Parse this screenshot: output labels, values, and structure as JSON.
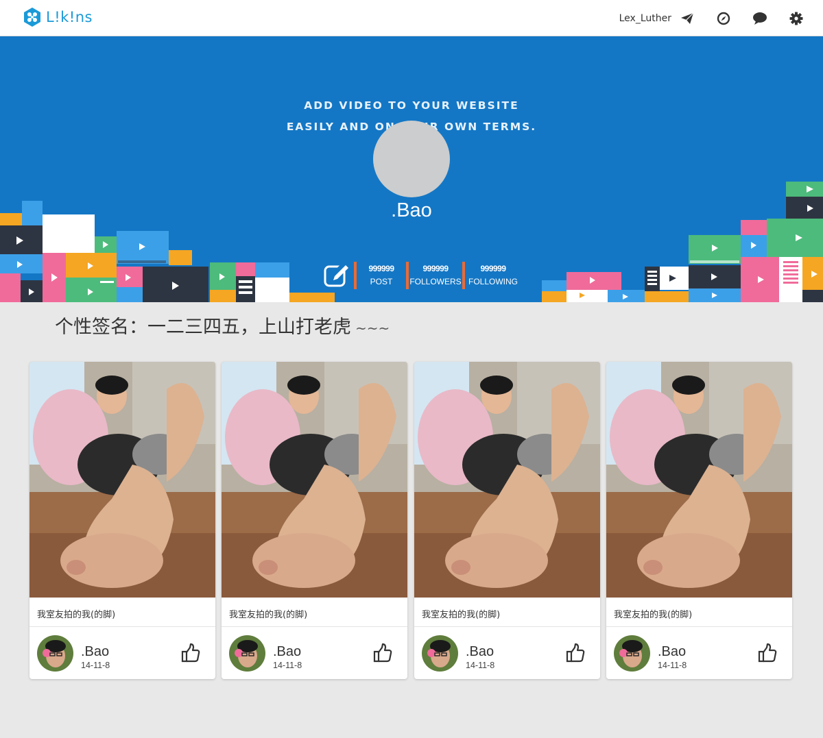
{
  "app": {
    "logo_text": "L!k!ns",
    "brand_color": "#1b9ad8"
  },
  "nav": {
    "username": "Lex_Luther",
    "icons": [
      "send-icon",
      "compass-icon",
      "chat-icon",
      "gear-icon"
    ]
  },
  "banner": {
    "tagline_line1": "ADD VIDEO TO YOUR WEBSITE",
    "tagline_line2": "EASILY AND ON YOUR OWN TERMS.",
    "background_color": "#1477c5",
    "profile_name": ".Bao",
    "stats": {
      "post_count": "999999",
      "post_label": "POST",
      "followers_count": "999999",
      "followers_label": "FOLLOWERS",
      "following_count": "999999",
      "following_label": "FOLLOWING"
    },
    "stat_divider_color": "#ef6a31"
  },
  "signature": {
    "text": "个性签名：一二三四五，上山打老虎",
    "suffix": "~~~"
  },
  "cards": [
    {
      "caption": "我室友拍的我(的脚)",
      "author": ".Bao",
      "date": "14-11-8"
    },
    {
      "caption": "我室友拍的我(的脚)",
      "author": ".Bao",
      "date": "14-11-8"
    },
    {
      "caption": "我室友拍的我(的脚)",
      "author": ".Bao",
      "date": "14-11-8"
    },
    {
      "caption": "我室友拍的我(的脚)",
      "author": ".Bao",
      "date": "14-11-8"
    }
  ]
}
